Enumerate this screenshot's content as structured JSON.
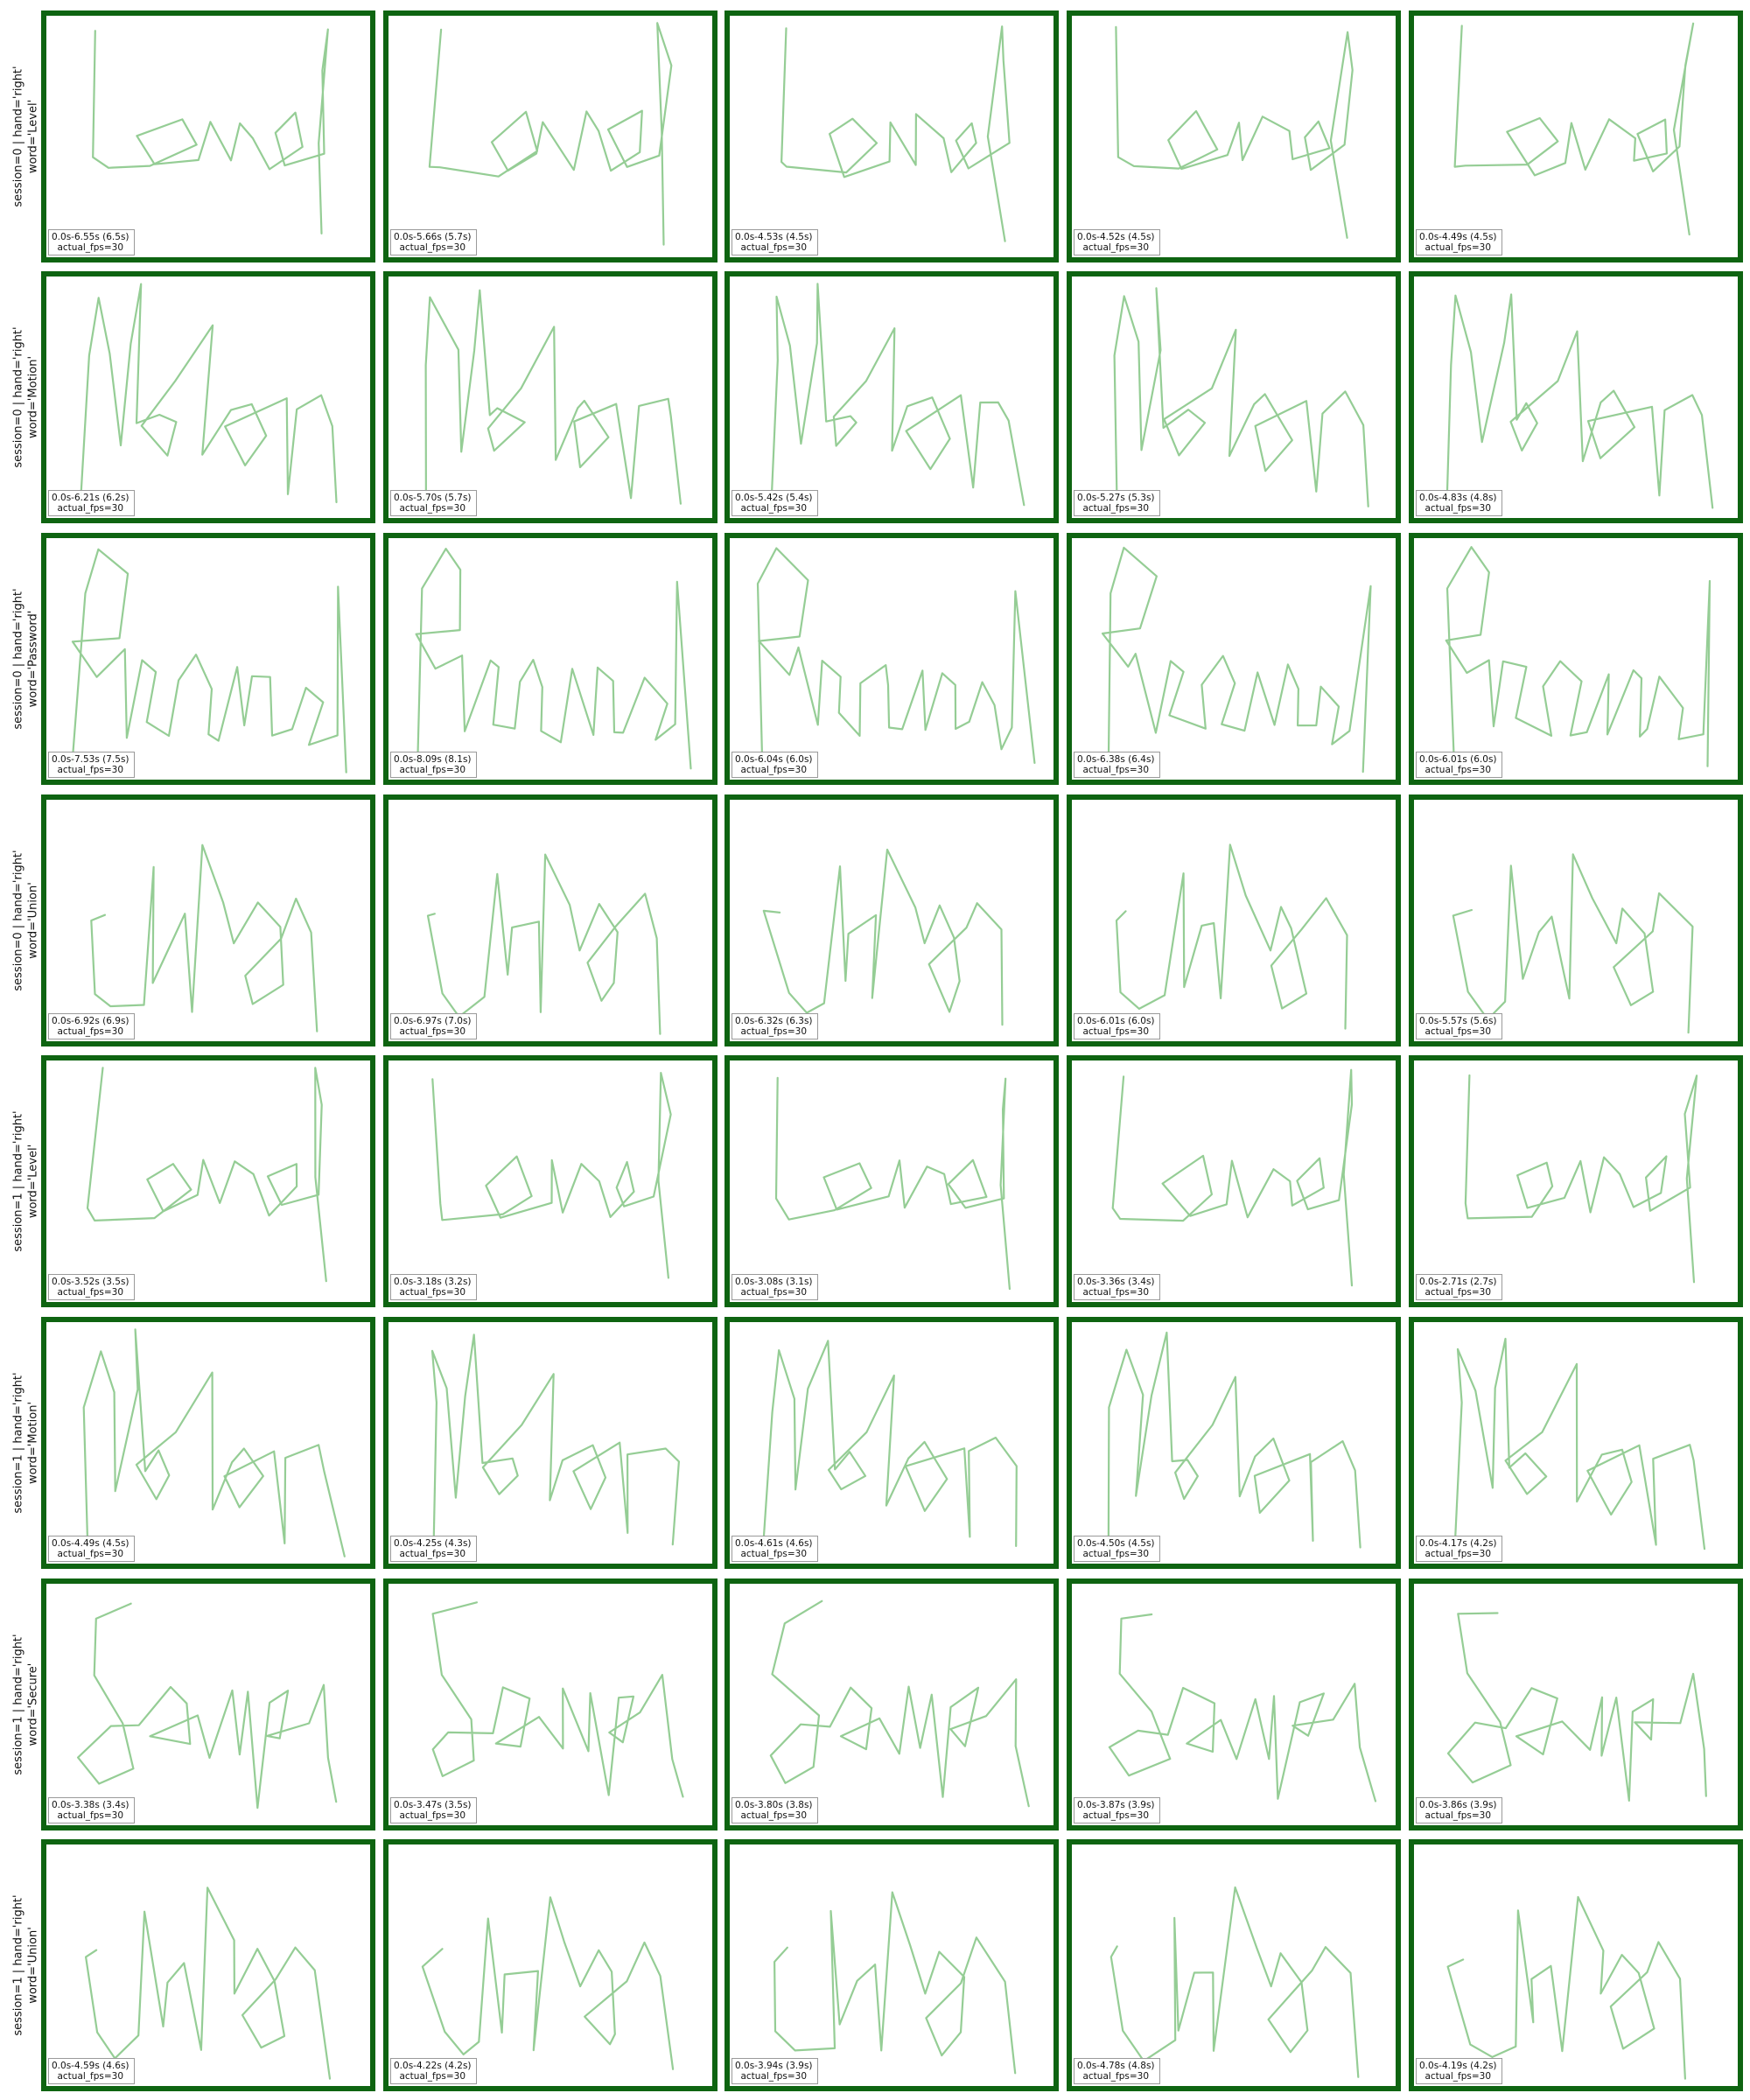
{
  "stroke_color": "#8fca8f",
  "border_color": "#0e6411",
  "rows": [
    {
      "session_label": "session=0 | hand='right'",
      "word_label": "word='Level'",
      "word": "Level",
      "panels": [
        {
          "time": "0.0s-6.55s (6.5s)",
          "fps": "actual_fps=30"
        },
        {
          "time": "0.0s-5.66s (5.7s)",
          "fps": "actual_fps=30"
        },
        {
          "time": "0.0s-4.53s (4.5s)",
          "fps": "actual_fps=30"
        },
        {
          "time": "0.0s-4.52s (4.5s)",
          "fps": "actual_fps=30"
        },
        {
          "time": "0.0s-4.49s (4.5s)",
          "fps": "actual_fps=30"
        }
      ]
    },
    {
      "session_label": "session=0 | hand='right'",
      "word_label": "word='Motion'",
      "word": "Motion",
      "panels": [
        {
          "time": "0.0s-6.21s (6.2s)",
          "fps": "actual_fps=30"
        },
        {
          "time": "0.0s-5.70s (5.7s)",
          "fps": "actual_fps=30"
        },
        {
          "time": "0.0s-5.42s (5.4s)",
          "fps": "actual_fps=30"
        },
        {
          "time": "0.0s-5.27s (5.3s)",
          "fps": "actual_fps=30"
        },
        {
          "time": "0.0s-4.83s (4.8s)",
          "fps": "actual_fps=30"
        }
      ]
    },
    {
      "session_label": "session=0 | hand='right'",
      "word_label": "word='Password'",
      "word": "Password",
      "panels": [
        {
          "time": "0.0s-7.53s (7.5s)",
          "fps": "actual_fps=30"
        },
        {
          "time": "0.0s-8.09s (8.1s)",
          "fps": "actual_fps=30"
        },
        {
          "time": "0.0s-6.04s (6.0s)",
          "fps": "actual_fps=30"
        },
        {
          "time": "0.0s-6.38s (6.4s)",
          "fps": "actual_fps=30"
        },
        {
          "time": "0.0s-6.01s (6.0s)",
          "fps": "actual_fps=30"
        }
      ]
    },
    {
      "session_label": "session=0 | hand='right'",
      "word_label": "word='Union'",
      "word": "Union",
      "panels": [
        {
          "time": "0.0s-6.92s (6.9s)",
          "fps": "actual_fps=30"
        },
        {
          "time": "0.0s-6.97s (7.0s)",
          "fps": "actual_fps=30"
        },
        {
          "time": "0.0s-6.32s (6.3s)",
          "fps": "actual_fps=30"
        },
        {
          "time": "0.0s-6.01s (6.0s)",
          "fps": "actual_fps=30"
        },
        {
          "time": "0.0s-5.57s (5.6s)",
          "fps": "actual_fps=30"
        }
      ]
    },
    {
      "session_label": "session=1 | hand='right'",
      "word_label": "word='Level'",
      "word": "Level",
      "panels": [
        {
          "time": "0.0s-3.52s (3.5s)",
          "fps": "actual_fps=30"
        },
        {
          "time": "0.0s-3.18s (3.2s)",
          "fps": "actual_fps=30"
        },
        {
          "time": "0.0s-3.08s (3.1s)",
          "fps": "actual_fps=30"
        },
        {
          "time": "0.0s-3.36s (3.4s)",
          "fps": "actual_fps=30"
        },
        {
          "time": "0.0s-2.71s (2.7s)",
          "fps": "actual_fps=30"
        }
      ]
    },
    {
      "session_label": "session=1 | hand='right'",
      "word_label": "word='Motion'",
      "word": "Motion",
      "panels": [
        {
          "time": "0.0s-4.49s (4.5s)",
          "fps": "actual_fps=30"
        },
        {
          "time": "0.0s-4.25s (4.3s)",
          "fps": "actual_fps=30"
        },
        {
          "time": "0.0s-4.61s (4.6s)",
          "fps": "actual_fps=30"
        },
        {
          "time": "0.0s-4.50s (4.5s)",
          "fps": "actual_fps=30"
        },
        {
          "time": "0.0s-4.17s (4.2s)",
          "fps": "actual_fps=30"
        }
      ]
    },
    {
      "session_label": "session=1 | hand='right'",
      "word_label": "word='Secure'",
      "word": "Secure",
      "panels": [
        {
          "time": "0.0s-3.38s (3.4s)",
          "fps": "actual_fps=30"
        },
        {
          "time": "0.0s-3.47s (3.5s)",
          "fps": "actual_fps=30"
        },
        {
          "time": "0.0s-3.80s (3.8s)",
          "fps": "actual_fps=30"
        },
        {
          "time": "0.0s-3.87s (3.9s)",
          "fps": "actual_fps=30"
        },
        {
          "time": "0.0s-3.86s (3.9s)",
          "fps": "actual_fps=30"
        }
      ]
    },
    {
      "session_label": "session=1 | hand='right'",
      "word_label": "word='Union'",
      "word": "Union",
      "panels": [
        {
          "time": "0.0s-4.59s (4.6s)",
          "fps": "actual_fps=30"
        },
        {
          "time": "0.0s-4.22s (4.2s)",
          "fps": "actual_fps=30"
        },
        {
          "time": "0.0s-3.94s (3.9s)",
          "fps": "actual_fps=30"
        },
        {
          "time": "0.0s-4.78s (4.8s)",
          "fps": "actual_fps=30"
        },
        {
          "time": "0.0s-4.19s (4.2s)",
          "fps": "actual_fps=30"
        }
      ]
    }
  ]
}
